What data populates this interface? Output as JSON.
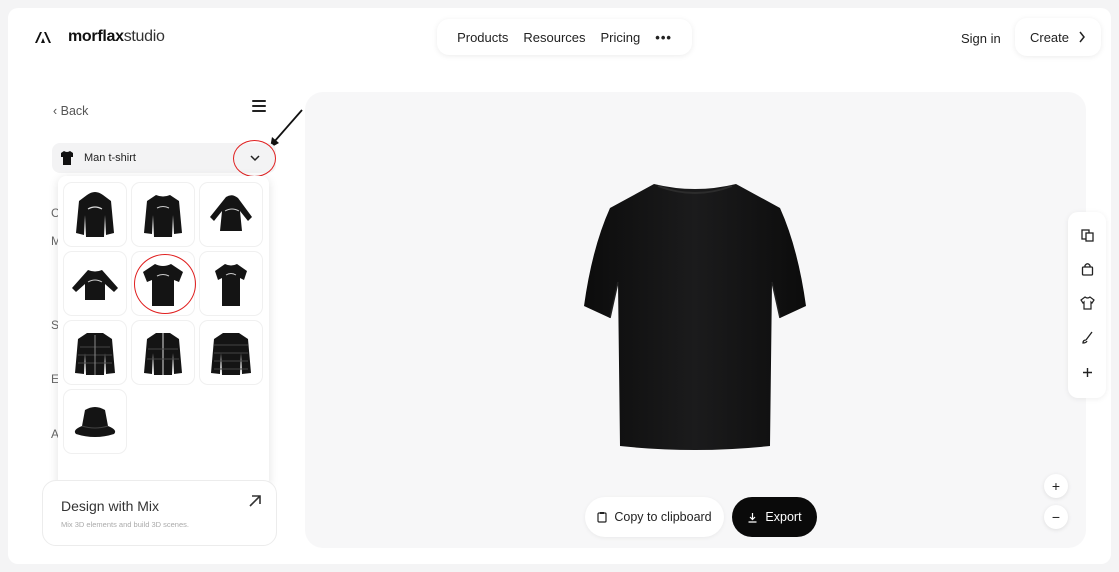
{
  "header": {
    "brand_bold": "morflax",
    "brand_light": "studio",
    "nav": [
      "Products",
      "Resources",
      "Pricing"
    ],
    "more": "•••",
    "sign_in": "Sign in",
    "create": "Create"
  },
  "panel": {
    "back": "Back",
    "selected_item": "Man t-shirt",
    "hidden_letters": [
      "C",
      "M",
      "S",
      "E",
      "A"
    ],
    "items": [
      "hoodie-front",
      "sweatshirt",
      "hoodie-side",
      "sweatshirt-flat",
      "man-tshirt",
      "tshirt",
      "puffer-jacket-open",
      "bomber-jacket",
      "puffer-jacket",
      "bucket-hat"
    ]
  },
  "design_card": {
    "title": "Design with Mix",
    "subtitle": "Mix 3D elements and build 3D scenes."
  },
  "viewer": {
    "copy": "Copy to clipboard",
    "export": "Export",
    "zoom_in": "+",
    "zoom_out": "−"
  },
  "toolbar": {
    "tools": [
      "copy-icon",
      "bag-icon",
      "shirt-icon",
      "brush-icon",
      "plus-icon"
    ]
  },
  "colors": {
    "highlight": "#e02020",
    "export_bg": "#0a0a0a",
    "viewer_bg": "#f7f7f8"
  }
}
